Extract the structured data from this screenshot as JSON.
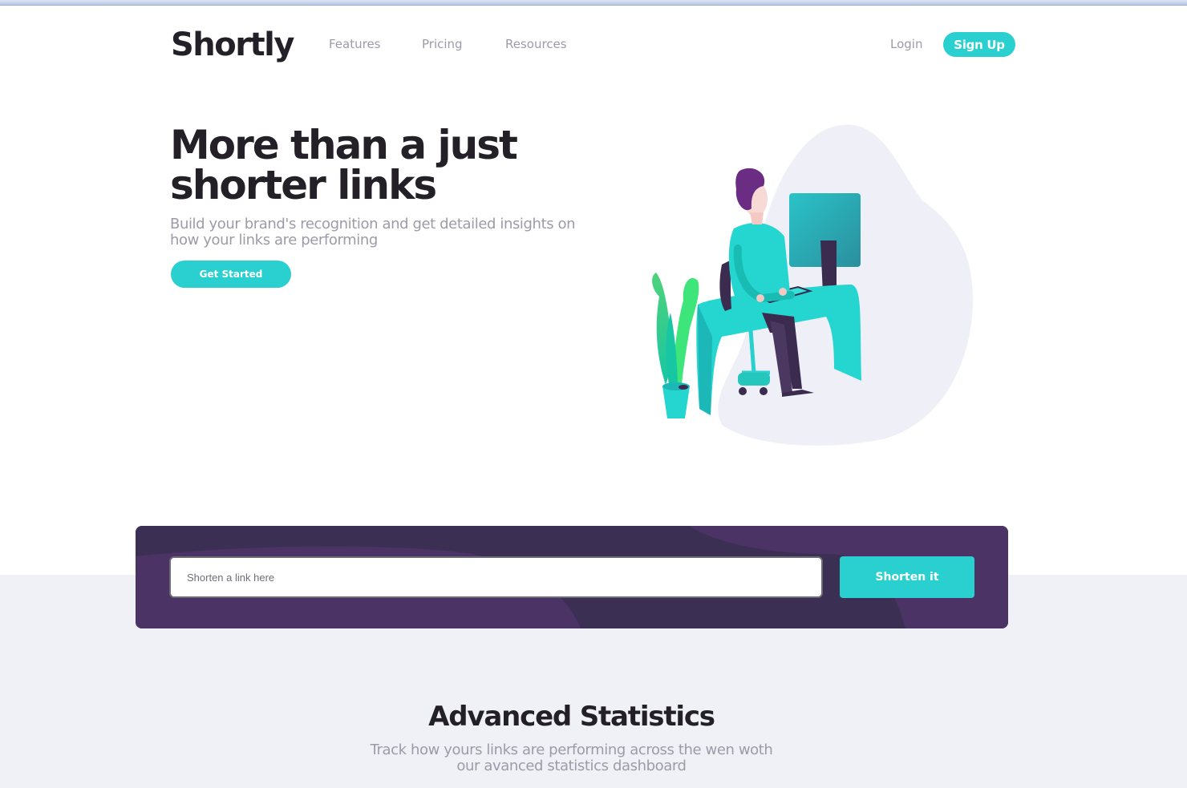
{
  "header": {
    "logo": "Shortly",
    "nav": [
      "Features",
      "Pricing",
      "Resources"
    ],
    "login": "Login",
    "signup": "Sign Up"
  },
  "hero": {
    "title": "More than a just shorter links",
    "subtitle": "Build your brand's recognition and get detailed insights on how your links are performing",
    "cta": "Get Started"
  },
  "shorten": {
    "placeholder": "Shorten a link here",
    "button": "Shorten it"
  },
  "stats": {
    "title": "Advanced Statistics",
    "subtitle": "Track how yours links are performing across the wen woth our avanced statistics dashboard"
  },
  "colors": {
    "accent": "#2acfcf",
    "dark_violet": "#3b3054",
    "gray_text": "#9e9aa8",
    "very_dark": "#232127",
    "illustration_blob": "#efeff7"
  }
}
